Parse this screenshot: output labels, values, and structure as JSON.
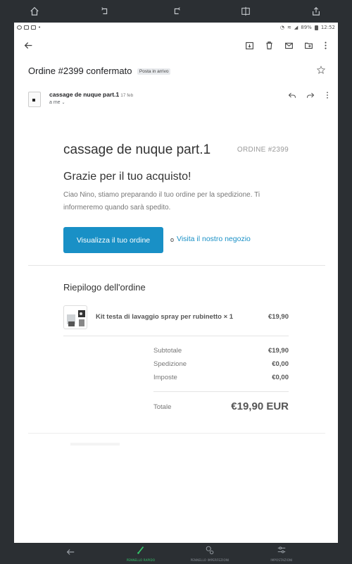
{
  "status_bar": {
    "battery": "89%",
    "time": "12:52"
  },
  "email": {
    "subject": "Ordine #2399 confermato",
    "label": "Posta in arrivo",
    "sender": "cassage de nuque part.1",
    "date": "17 feb",
    "recipient": "a me"
  },
  "body": {
    "shop_name": "cassage de nuque part.1",
    "order_number": "ORDINE #2399",
    "thanks": "Grazie per il tuo acquisto!",
    "message": "Ciao Nino, stiamo preparando il tuo ordine per la spedizione. Ti informeremo quando sarà spedito.",
    "primary_button": "Visualizza il tuo ordine",
    "or_text": "o",
    "shop_link": "Visita il nostro negozio"
  },
  "summary": {
    "title": "Riepilogo dell'ordine",
    "item": {
      "name": "Kit testa di lavaggio spray per rubinetto × 1",
      "price": "€19,90"
    },
    "subtotal_label": "Subtotale",
    "subtotal": "€19,90",
    "shipping_label": "Spedizione",
    "shipping": "€0,00",
    "taxes_label": "Imposte",
    "taxes": "€0,00",
    "total_label": "Totale",
    "total": "€19,90 EUR"
  },
  "bottom_toolbar": {
    "tools": [
      "PENNELLO RAPIDO",
      "PENNELLO IMPERFEZIONI",
      "IMPOSTAZIONI"
    ]
  },
  "colors": {
    "accent": "#1990c6",
    "tool_active": "#35c66b",
    "toolbar_bg": "#2b2f33"
  }
}
